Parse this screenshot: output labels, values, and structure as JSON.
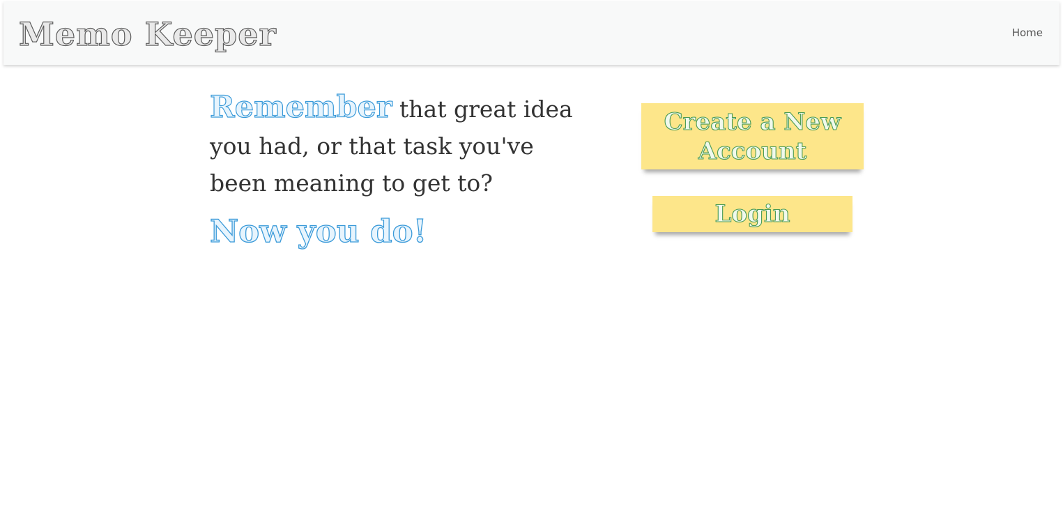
{
  "app": {
    "brand": "Memo Keeper"
  },
  "nav": {
    "home_label": "Home"
  },
  "hero": {
    "highlight": "Remember",
    "body": " that great idea you had, or that task you've been meaning to get to?",
    "tagline": "Now you do!"
  },
  "actions": {
    "create_account_label": "Create a New Account",
    "login_label": "Login"
  },
  "colors": {
    "navbar_bg": "#f8f9f9",
    "brand_outline": "#5b5b5b",
    "accent_blue": "#3a9ad9",
    "sticky_yellow": "#fde68a",
    "button_text_green": "#4a9a54",
    "body_text": "#333333"
  }
}
